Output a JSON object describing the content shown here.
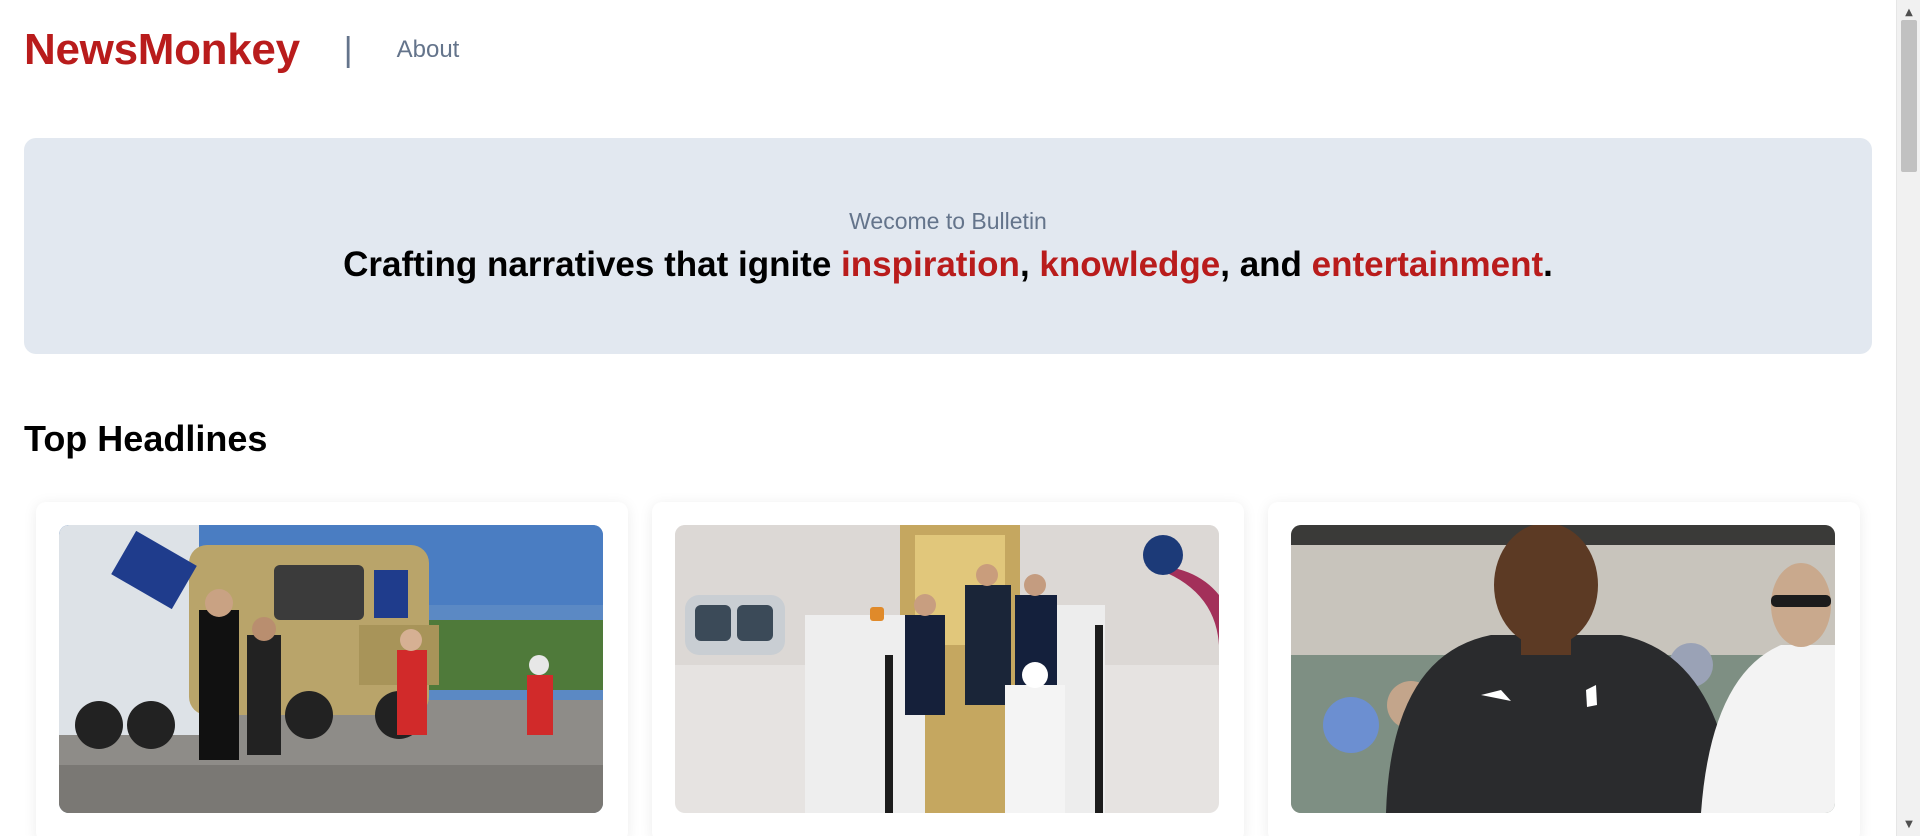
{
  "navbar": {
    "brand": "NewsMonkey",
    "separator": "|",
    "about_link": "About"
  },
  "hero": {
    "subtitle": "Wecome to Bulletin",
    "title_part1": "Crafting narratives that ignite ",
    "highlight1": "inspiration",
    "sep1": ", ",
    "highlight2": "knowledge",
    "sep2": ", and ",
    "highlight3": "entertainment",
    "end": "."
  },
  "section": {
    "title": "Top Headlines"
  },
  "cards": [
    {
      "image": "uaw-strike-picketers-photo"
    },
    {
      "image": "officials-descending-aircraft-stairs-photo"
    },
    {
      "image": "msu-football-coach-photo"
    }
  ],
  "colors": {
    "brand": "#b91c1c",
    "muted": "#64748b",
    "hero_bg": "#e2e8f0"
  },
  "scrollbar": {
    "up_icon": "triangle-up-icon",
    "down_icon": "triangle-down-icon"
  }
}
